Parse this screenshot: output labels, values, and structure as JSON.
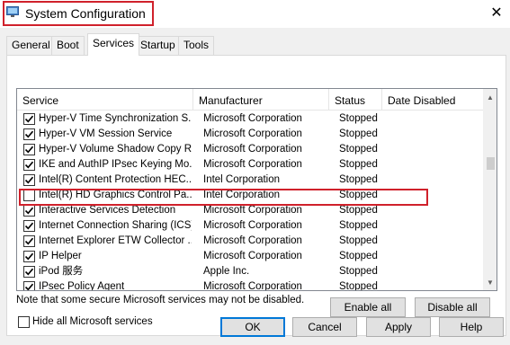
{
  "window": {
    "title": "System Configuration",
    "icon": "system-config-icon",
    "close_glyph": "✕"
  },
  "tabs": [
    {
      "label": "General",
      "active": false
    },
    {
      "label": "Boot",
      "active": false
    },
    {
      "label": "Services",
      "active": true
    },
    {
      "label": "Startup",
      "active": false
    },
    {
      "label": "Tools",
      "active": false
    }
  ],
  "services_table": {
    "columns": {
      "service": "Service",
      "manufacturer": "Manufacturer",
      "status": "Status",
      "date_disabled": "Date Disabled"
    },
    "sort_glyph": "^",
    "rows": [
      {
        "checked": true,
        "service": "Hyper-V Time Synchronization S...",
        "manufacturer": "Microsoft Corporation",
        "status": "Stopped"
      },
      {
        "checked": true,
        "service": "Hyper-V VM Session Service",
        "manufacturer": "Microsoft Corporation",
        "status": "Stopped"
      },
      {
        "checked": true,
        "service": "Hyper-V Volume Shadow Copy R...",
        "manufacturer": "Microsoft Corporation",
        "status": "Stopped"
      },
      {
        "checked": true,
        "service": "IKE and AuthIP IPsec Keying Mo...",
        "manufacturer": "Microsoft Corporation",
        "status": "Stopped"
      },
      {
        "checked": true,
        "service": "Intel(R) Content Protection HEC...",
        "manufacturer": "Intel Corporation",
        "status": "Stopped"
      },
      {
        "checked": false,
        "service": "Intel(R) HD Graphics Control Pa...",
        "manufacturer": "Intel Corporation",
        "status": "Stopped",
        "highlighted": true
      },
      {
        "checked": true,
        "service": "Interactive Services Detection",
        "manufacturer": "Microsoft Corporation",
        "status": "Stopped"
      },
      {
        "checked": true,
        "service": "Internet Connection Sharing (ICS)",
        "manufacturer": "Microsoft Corporation",
        "status": "Stopped"
      },
      {
        "checked": true,
        "service": "Internet Explorer ETW Collector ...",
        "manufacturer": "Microsoft Corporation",
        "status": "Stopped"
      },
      {
        "checked": true,
        "service": "IP Helper",
        "manufacturer": "Microsoft Corporation",
        "status": "Stopped"
      },
      {
        "checked": true,
        "service": "iPod 服务",
        "manufacturer": "Apple Inc.",
        "status": "Stopped"
      },
      {
        "checked": true,
        "service": "IPsec Policy Agent",
        "manufacturer": "Microsoft Corporation",
        "status": "Stopped"
      }
    ]
  },
  "note": "Note that some secure Microsoft services may not be disabled.",
  "buttons": {
    "enable_all": "Enable all",
    "disable_all": "Disable all",
    "ok": "OK",
    "cancel": "Cancel",
    "apply": "Apply",
    "help": "Help"
  },
  "hide_ms_services": {
    "label": "Hide all Microsoft services",
    "checked": false
  },
  "colors": {
    "highlight_red": "#d0212b",
    "window_bg": "#f0f0f0",
    "primary_border": "#0078d7"
  }
}
